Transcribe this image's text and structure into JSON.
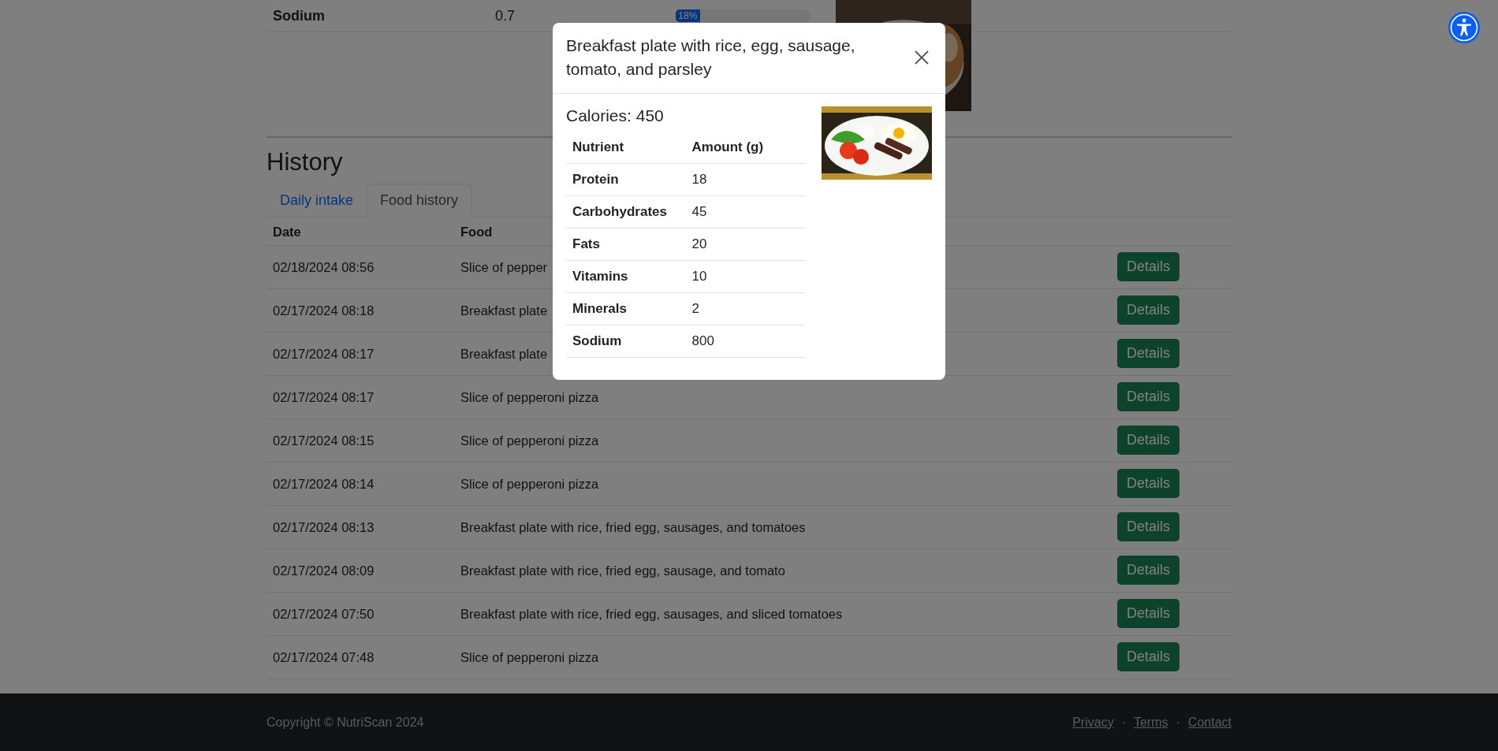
{
  "nutrients": {
    "rows": [
      {
        "nutrient": "Sodium",
        "amount": "0.7",
        "percent": "18%",
        "level": 0.18
      }
    ]
  },
  "history": {
    "title": "History",
    "tabs": [
      {
        "label": "Daily intake",
        "selected": false
      },
      {
        "label": "Food history",
        "selected": true
      }
    ],
    "columns": [
      "Date",
      "Food"
    ],
    "rows": [
      {
        "date": "02/18/2024 08:56",
        "food": "Slice of pepper",
        "action": "Details"
      },
      {
        "date": "02/17/2024 08:18",
        "food": "Breakfast plate",
        "action": "Details"
      },
      {
        "date": "02/17/2024 08:17",
        "food": "Breakfast plate",
        "action": "Details"
      },
      {
        "date": "02/17/2024 08:17",
        "food": "Slice of pepperoni pizza",
        "action": "Details"
      },
      {
        "date": "02/17/2024 08:15",
        "food": "Slice of pepperoni pizza",
        "action": "Details"
      },
      {
        "date": "02/17/2024 08:14",
        "food": "Slice of pepperoni pizza",
        "action": "Details"
      },
      {
        "date": "02/17/2024 08:13",
        "food": "Breakfast plate with rice, fried egg, sausages, and tomatoes",
        "action": "Details"
      },
      {
        "date": "02/17/2024 08:09",
        "food": "Breakfast plate with rice, fried egg, sausage, and tomato",
        "action": "Details"
      },
      {
        "date": "02/17/2024 07:50",
        "food": "Breakfast plate with rice, fried egg, sausages, and sliced tomatoes",
        "action": "Details"
      },
      {
        "date": "02/17/2024 07:48",
        "food": "Slice of pepperoni pizza",
        "action": "Details"
      }
    ]
  },
  "modal": {
    "title": "Breakfast plate with rice, egg, sausage, tomato, and parsley",
    "calories": "Calories: 450",
    "columns": [
      "Nutrient",
      "Amount (g)"
    ],
    "rows": [
      {
        "nutrient": "Protein",
        "amount": "18"
      },
      {
        "nutrient": "Carbohydrates",
        "amount": "45"
      },
      {
        "nutrient": "Fats",
        "amount": "20"
      },
      {
        "nutrient": "Vitamins",
        "amount": "10"
      },
      {
        "nutrient": "Minerals",
        "amount": "2"
      },
      {
        "nutrient": "Sodium",
        "amount": "800"
      }
    ]
  },
  "footer": {
    "copyright": "Copyright © NutriScan 2024",
    "links": [
      "Privacy",
      "Terms",
      "Contact"
    ],
    "separators": [
      "·",
      "·"
    ]
  }
}
